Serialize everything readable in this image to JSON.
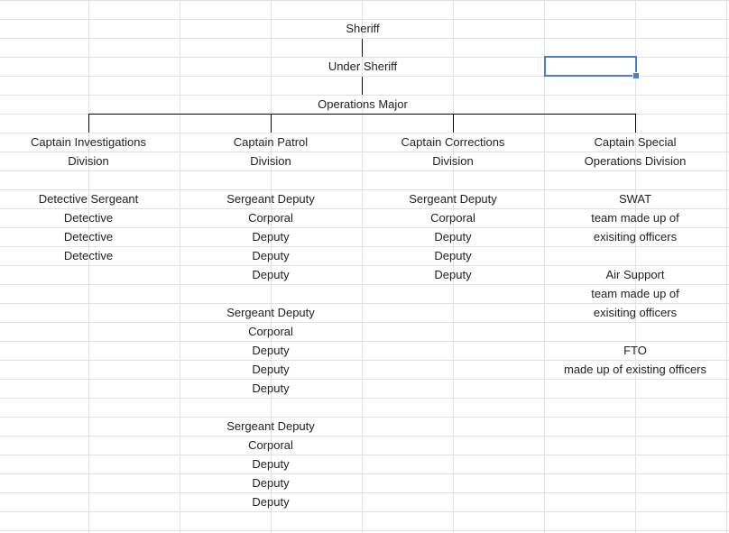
{
  "org": {
    "sheriff": "Sheriff",
    "under_sheriff": "Under Sheriff",
    "operations_major": "Operations Major"
  },
  "divisions": {
    "investigations": {
      "title_line1": "Captain Investigations",
      "title_line2": "Division",
      "members": [
        "Detective Sergeant",
        "Detective",
        "Detective",
        "Detective"
      ]
    },
    "patrol": {
      "title_line1": "Captain Patrol",
      "title_line2": "Division",
      "squads": [
        [
          "Sergeant Deputy",
          "Corporal",
          "Deputy",
          "Deputy",
          "Deputy"
        ],
        [
          "Sergeant Deputy",
          "Corporal",
          "Deputy",
          "Deputy",
          "Deputy"
        ],
        [
          "Sergeant Deputy",
          "Corporal",
          "Deputy",
          "Deputy",
          "Deputy"
        ]
      ]
    },
    "corrections": {
      "title_line1": "Captain Corrections",
      "title_line2": "Division",
      "members": [
        "Sergeant Deputy",
        "Corporal",
        "Deputy",
        "Deputy",
        "Deputy"
      ]
    },
    "special": {
      "title_line1": "Captain Special",
      "title_line2": "Operations Division",
      "units": [
        [
          "SWAT",
          "team made up of",
          "exisiting officers"
        ],
        [
          "Air Support",
          "team made up of",
          "exisiting officers"
        ],
        [
          "FTO",
          "made up of existing officers"
        ]
      ]
    }
  },
  "colors": {
    "gridline": "#e2e2e2",
    "selection": "#4a7fd0",
    "connector": "#000000"
  }
}
